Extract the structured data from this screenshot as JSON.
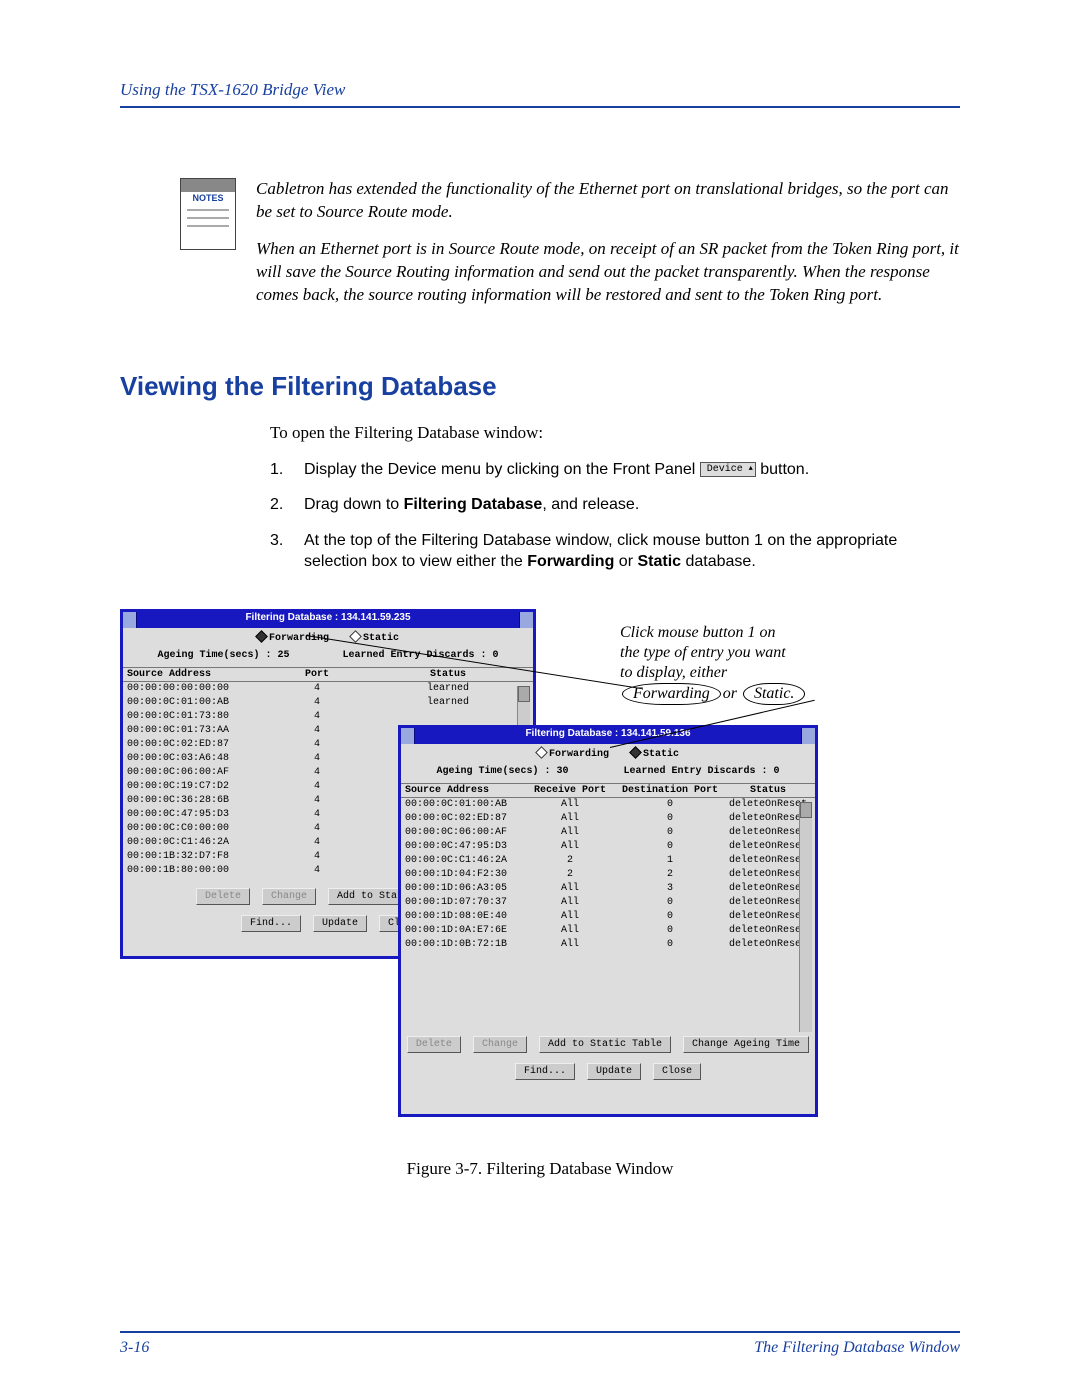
{
  "header": {
    "running": "Using the TSX-1620 Bridge View"
  },
  "notes": {
    "label": "NOTES",
    "p1": "Cabletron has extended the functionality of the Ethernet port on translational bridges, so the port can be set to Source Route mode.",
    "p2": "When an Ethernet port is in Source Route mode, on receipt of an SR packet from the Token Ring port, it will save the Source Routing information and send out the packet transparently. When the response comes back, the source routing information will be restored and sent to the Token Ring port."
  },
  "section_title": "Viewing the Filtering Database",
  "intro": "To open the Filtering Database window:",
  "steps": {
    "s1a": "Display the Device menu by clicking on the Front Panel ",
    "s1_btn": "Device",
    "s1b": " button.",
    "s2a": "Drag down to ",
    "s2bold": "Filtering Database",
    "s2b": ", and release.",
    "s3a": "At the top of the Filtering Database window, click mouse button 1 on the appropriate selection box to view either the ",
    "s3b1": "Forwarding",
    "s3mid": " or ",
    "s3b2": "Static",
    "s3c": " database."
  },
  "annotation": {
    "l1": "Click mouse button 1 on",
    "l2": "the type of entry you want",
    "l3": "to display, either",
    "ov1": "Forwarding",
    "or": "or ",
    "ov2": "Static."
  },
  "windows": {
    "fwd": {
      "title": "Filtering Database : 134.141.59.235",
      "radio_fwd": "Forwarding",
      "radio_static": "Static",
      "ageing": "Ageing Time(secs) : 25",
      "discards": "Learned Entry Discards : 0",
      "cols": {
        "addr": "Source Address",
        "port": "Port",
        "status": "Status"
      },
      "rows": [
        {
          "addr": "00:00:00:00:00:00",
          "port": "4",
          "status": "learned"
        },
        {
          "addr": "00:00:0C:01:00:AB",
          "port": "4",
          "status": "learned"
        },
        {
          "addr": "00:00:0C:01:73:80",
          "port": "4",
          "status": ""
        },
        {
          "addr": "00:00:0C:01:73:AA",
          "port": "4",
          "status": ""
        },
        {
          "addr": "00:00:0C:02:ED:87",
          "port": "4",
          "status": ""
        },
        {
          "addr": "00:00:0C:03:A6:48",
          "port": "4",
          "status": ""
        },
        {
          "addr": "00:00:0C:06:00:AF",
          "port": "4",
          "status": ""
        },
        {
          "addr": "00:00:0C:19:C7:D2",
          "port": "4",
          "status": ""
        },
        {
          "addr": "00:00:0C:36:28:6B",
          "port": "4",
          "status": ""
        },
        {
          "addr": "00:00:0C:47:95:D3",
          "port": "4",
          "status": ""
        },
        {
          "addr": "00:00:0C:C0:00:00",
          "port": "4",
          "status": ""
        },
        {
          "addr": "00:00:0C:C1:46:2A",
          "port": "4",
          "status": ""
        },
        {
          "addr": "00:00:1B:32:D7:F8",
          "port": "4",
          "status": ""
        },
        {
          "addr": "00:00:1B:80:00:00",
          "port": "4",
          "status": ""
        }
      ],
      "btns": {
        "delete": "Delete",
        "change": "Change",
        "addstatic": "Add to Static Table",
        "find": "Find...",
        "update": "Update",
        "close": "Clo"
      }
    },
    "sta": {
      "title": "Filtering Database : 134.141.59.136",
      "radio_fwd": "Forwarding",
      "radio_static": "Static",
      "ageing": "Ageing Time(secs) : 30",
      "discards": "Learned Entry Discards : 0",
      "cols": {
        "addr": "Source Address",
        "rp": "Receive Port",
        "dp": "Destination Port",
        "st": "Status"
      },
      "rows": [
        {
          "addr": "00:00:0C:01:00:AB",
          "rp": "All",
          "dp": "0",
          "st": "deleteOnReset"
        },
        {
          "addr": "00:00:0C:02:ED:87",
          "rp": "All",
          "dp": "0",
          "st": "deleteOnReset"
        },
        {
          "addr": "00:00:0C:06:00:AF",
          "rp": "All",
          "dp": "0",
          "st": "deleteOnReset"
        },
        {
          "addr": "00:00:0C:47:95:D3",
          "rp": "All",
          "dp": "0",
          "st": "deleteOnReset"
        },
        {
          "addr": "00:00:0C:C1:46:2A",
          "rp": "2",
          "dp": "1",
          "st": "deleteOnReset"
        },
        {
          "addr": "00:00:1D:04:F2:30",
          "rp": "2",
          "dp": "2",
          "st": "deleteOnReset"
        },
        {
          "addr": "00:00:1D:06:A3:05",
          "rp": "All",
          "dp": "3",
          "st": "deleteOnReset"
        },
        {
          "addr": "00:00:1D:07:70:37",
          "rp": "All",
          "dp": "0",
          "st": "deleteOnReset"
        },
        {
          "addr": "00:00:1D:08:0E:40",
          "rp": "All",
          "dp": "0",
          "st": "deleteOnReset"
        },
        {
          "addr": "00:00:1D:0A:E7:6E",
          "rp": "All",
          "dp": "0",
          "st": "deleteOnReset"
        },
        {
          "addr": "00:00:1D:0B:72:1B",
          "rp": "All",
          "dp": "0",
          "st": "deleteOnReset"
        }
      ],
      "btns": {
        "delete": "Delete",
        "change": "Change",
        "addstatic": "Add to Static Table",
        "chage": "Change Ageing Time",
        "find": "Find...",
        "update": "Update",
        "close": "Close"
      }
    }
  },
  "figure_caption": "Figure 3-7. Filtering Database Window",
  "footer": {
    "page": "3-16",
    "section": "The Filtering Database Window"
  }
}
